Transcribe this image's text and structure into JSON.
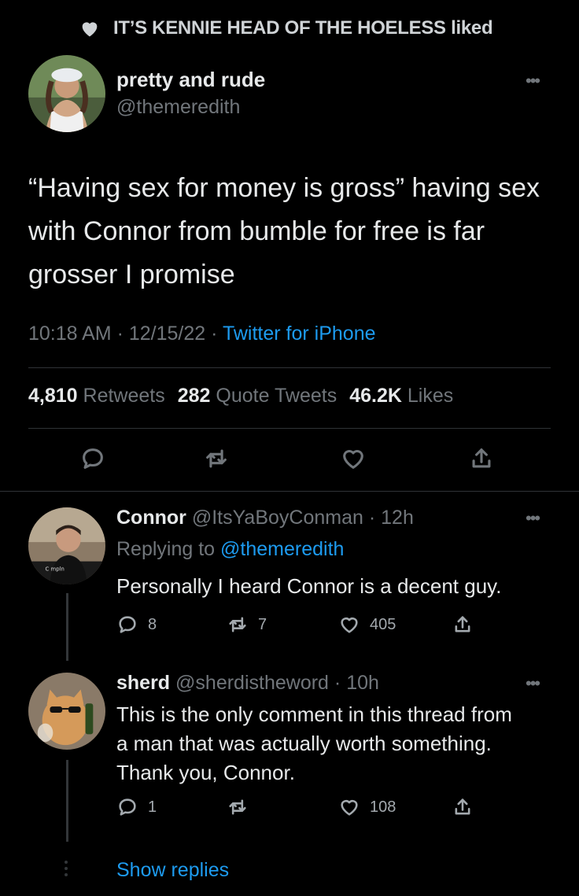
{
  "liked_banner": {
    "text": "IT’S KENNIE HEAD OF THE HOELESS liked",
    "icon": "heart-icon"
  },
  "main_tweet": {
    "display_name": "pretty and rude",
    "handle": "@themeredith",
    "text": "“Having sex for money is gross” having sex with Connor from bumble for free is far grosser I promise",
    "time": "10:18 AM",
    "date": "12/15/22",
    "separator": "·",
    "source": "Twitter for iPhone",
    "stats": {
      "retweets_count": "4,810",
      "retweets_label": "Retweets",
      "quotes_count": "282",
      "quotes_label": "Quote Tweets",
      "likes_count": "46.2K",
      "likes_label": "Likes"
    }
  },
  "replies": [
    {
      "display_name": "Connor",
      "handle": "@ItsYaBoyConman",
      "time": "12h",
      "replying_label": "Replying to",
      "replying_to": "@themeredith",
      "text": "Personally I heard Connor is a decent guy.",
      "reply_count": "8",
      "retweet_count": "7",
      "like_count": "405"
    },
    {
      "display_name": "sherd",
      "handle": "@sherdistheword",
      "time": "10h",
      "text": "This is the only comment in this thread from a man that was actually worth something. Thank you, Connor.",
      "reply_count": "1",
      "retweet_count": "",
      "like_count": "108"
    }
  ],
  "show_replies": "Show replies",
  "colors": {
    "background": "#000000",
    "text": "#e7e9ea",
    "secondary": "#71767b",
    "link": "#1d9bf0",
    "divider": "#2f3336"
  }
}
